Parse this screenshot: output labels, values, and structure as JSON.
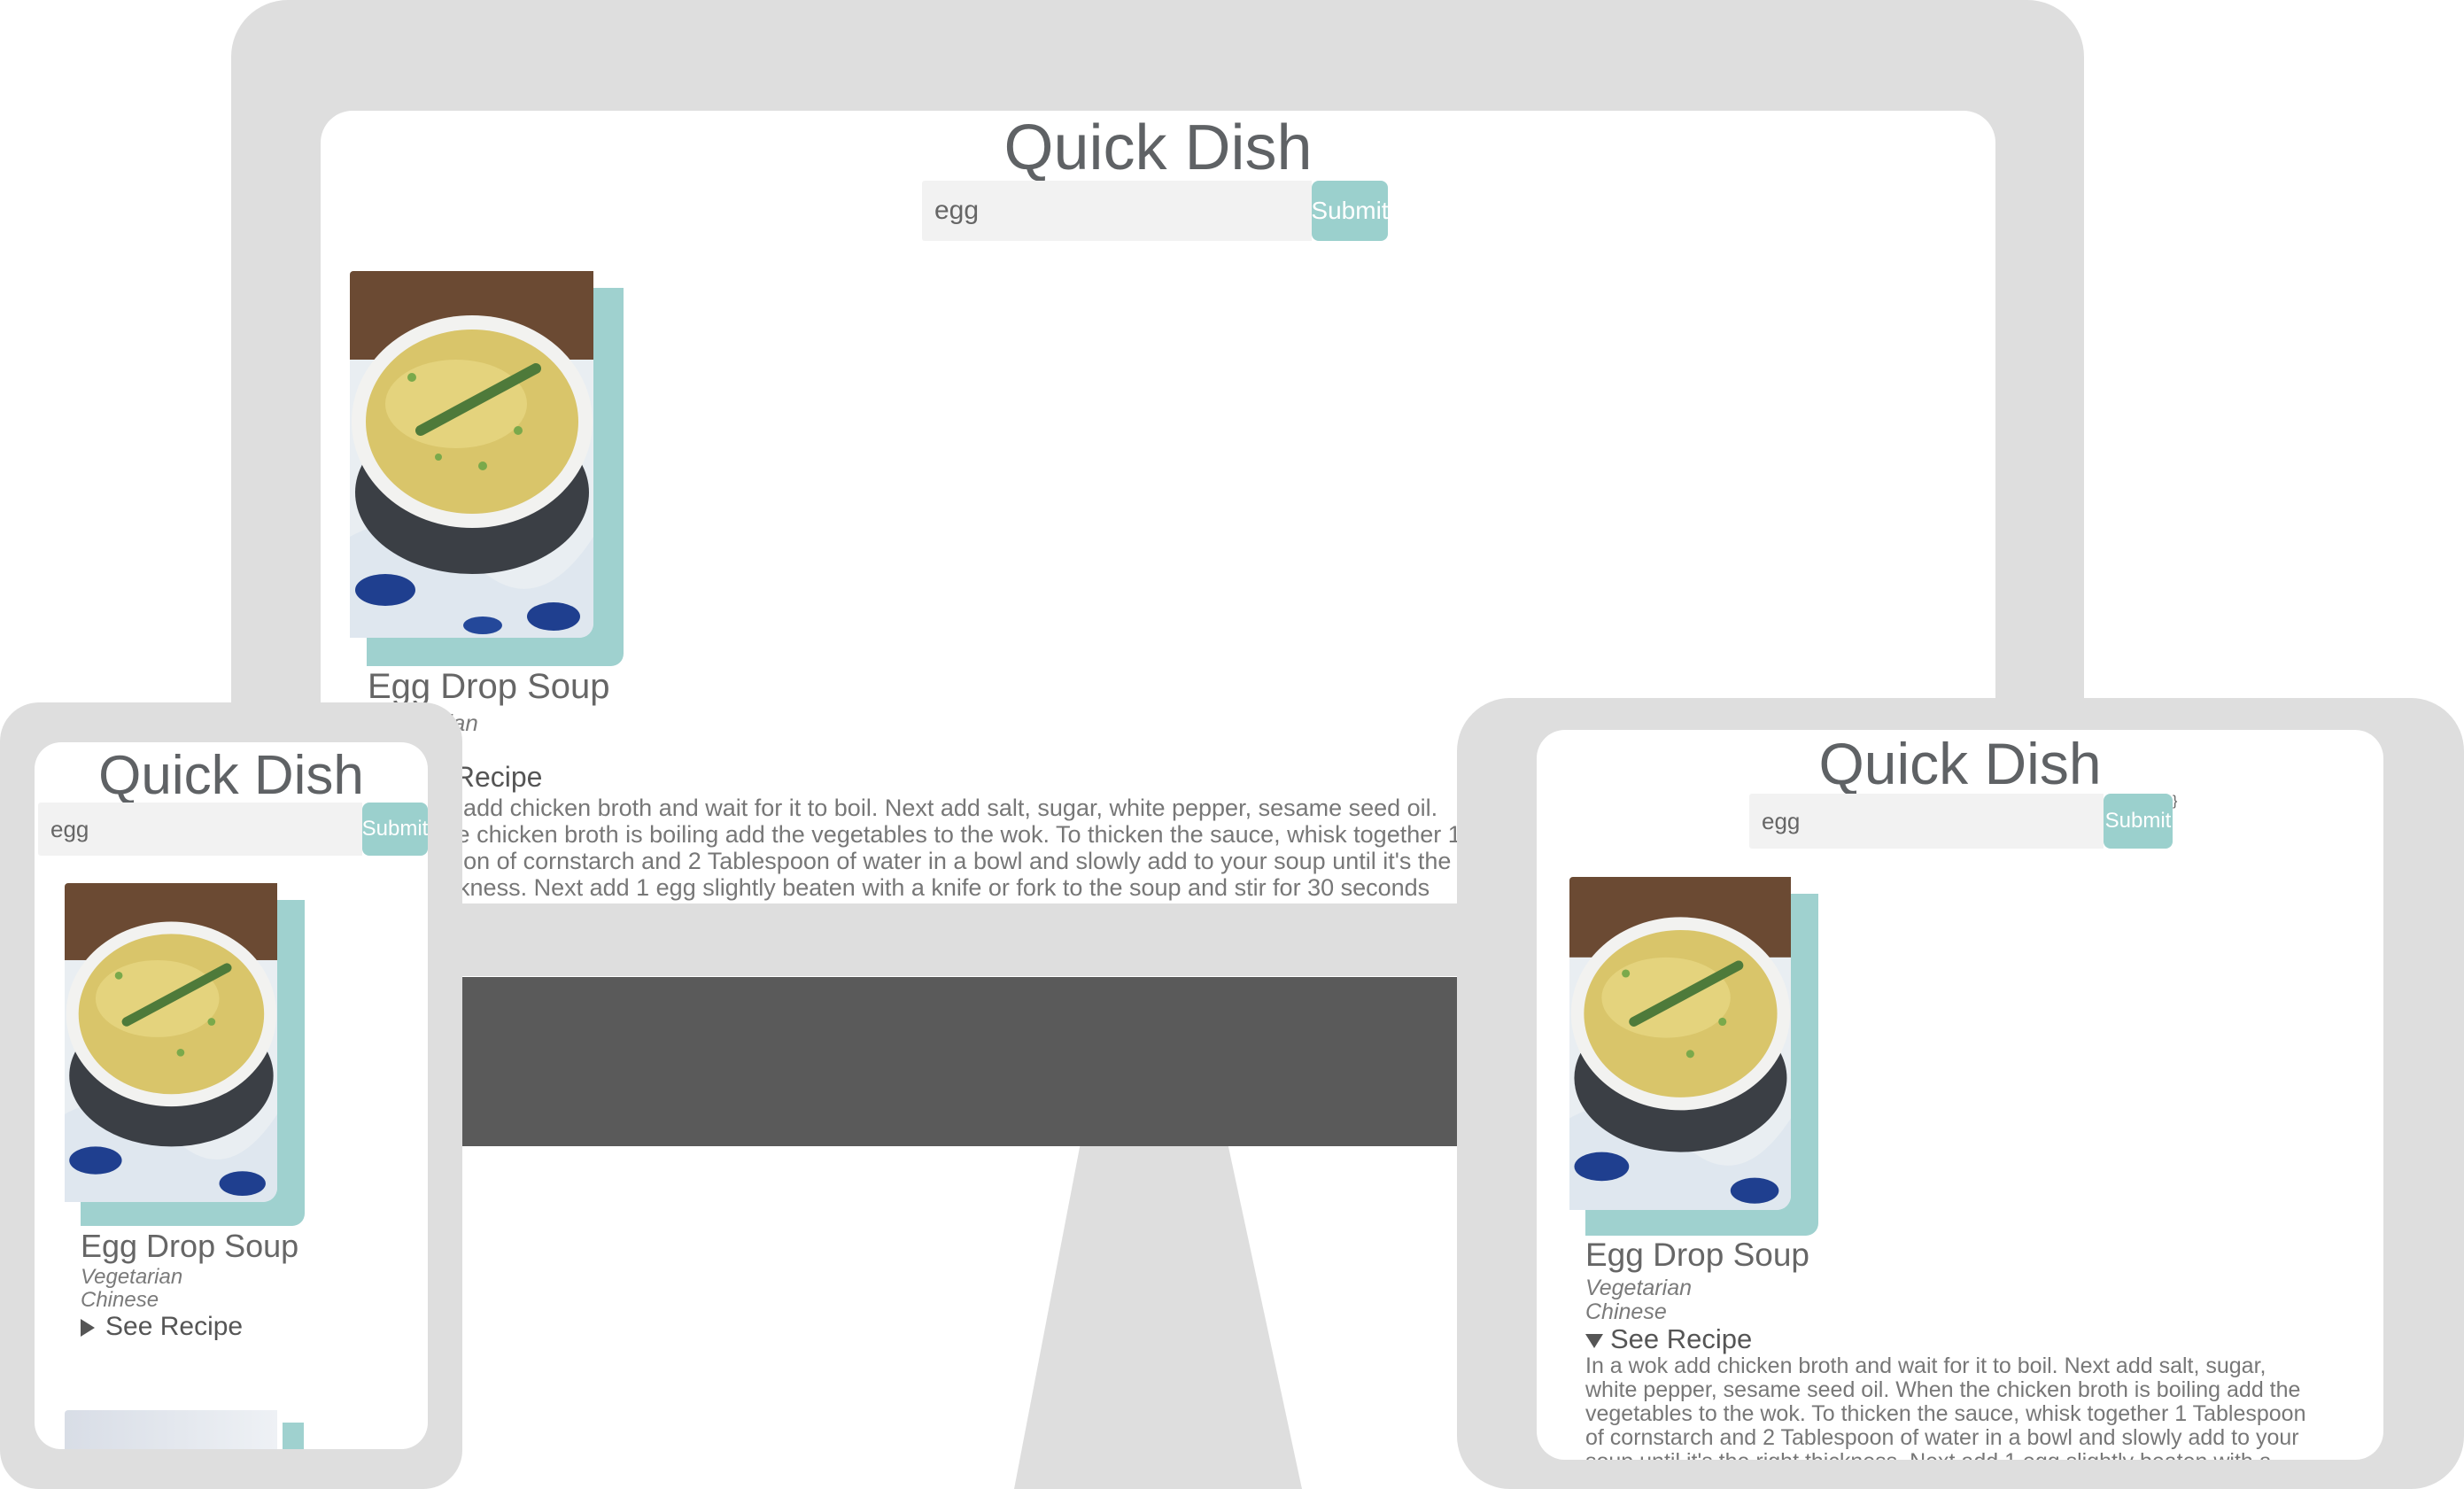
{
  "app": {
    "title": "Quick Dish",
    "search": {
      "value": "egg",
      "placeholder": ""
    },
    "submit_label": "Submit"
  },
  "recipe": {
    "name": "Egg Drop Soup",
    "tags": [
      "Vegetarian",
      "Chinese"
    ],
    "see_recipe_label": "See Recipe",
    "instructions": "In a wok add chicken broth and wait for it to boil. Next add salt, sugar, white pepper, sesame seed oil. When the chicken broth is boiling add the vegetables to the wok. To thicken the sauce, whisk together 1 Tablespoon of cornstarch and 2 Tablespoon of water in a bowl and slowly add to your soup until it's the right thickness. Next add 1 egg slightly beaten with a knife or fork to the soup and stir for 30 seconds Serve the soup in a bowl and add the green onions on top."
  },
  "devices": {
    "desktop": {
      "recipe_expanded": true
    },
    "tablet": {
      "recipe_expanded": true
    },
    "phone": {
      "recipe_expanded": false
    }
  },
  "colors": {
    "device_frame": "#dedede",
    "monitor_stand": "#5a5a5a",
    "accent": "#9bd0cd",
    "title_text": "#5f6265"
  }
}
